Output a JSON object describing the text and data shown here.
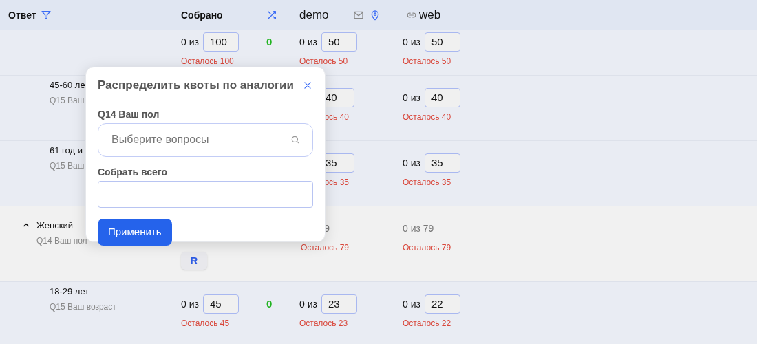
{
  "header": {
    "answer": "Ответ",
    "collected": "Собрано",
    "demo": "demo",
    "web": "web"
  },
  "rows": [
    {
      "kind": "option",
      "collected": {
        "prefix": "0 из",
        "value": "100",
        "remaining": "Осталось 100"
      },
      "difference": "0",
      "demo": {
        "prefix": "0 из",
        "value": "50",
        "remaining": "Осталось 50"
      },
      "web": {
        "prefix": "0 из",
        "value": "50",
        "remaining": "Осталось 50"
      }
    },
    {
      "kind": "option",
      "label": "45-60 ле",
      "sublabel": "Q15 Ваш",
      "demo": {
        "value": "40",
        "remaining": "ось 40"
      },
      "web": {
        "prefix": "0 из",
        "value": "40",
        "remaining": "Осталось 40"
      }
    },
    {
      "kind": "option",
      "label": "61 год и",
      "sublabel": "Q15 Ваш",
      "demo": {
        "value": "35",
        "remaining": "ось 35"
      },
      "web": {
        "prefix": "0 из",
        "value": "35",
        "remaining": "Осталось 35"
      }
    },
    {
      "kind": "group",
      "label": "Женский",
      "sublabel": "Q14 Ваш пол",
      "expanded": true,
      "demo": {
        "text": "9",
        "remaining": "Осталось 79"
      },
      "web": {
        "text": "0 из 79",
        "remaining": "Осталось 79"
      },
      "action": "R"
    },
    {
      "kind": "option",
      "label": "18-29 лет",
      "sublabel": "Q15 Ваш возраст",
      "collected": {
        "prefix": "0 из",
        "value": "45",
        "remaining": "Осталось 45"
      },
      "difference": "0",
      "demo": {
        "prefix": "0 из",
        "value": "23",
        "remaining": "Осталось 23"
      },
      "web": {
        "prefix": "0 из",
        "value": "22",
        "remaining": "Осталось 22"
      }
    }
  ],
  "popup": {
    "title": "Распределить квоты по аналогии",
    "fields": [
      {
        "kind": "search",
        "label": "Q14 Ваш пол",
        "placeholder": "Выберите вопросы"
      },
      {
        "kind": "text",
        "label": "Собрать всего"
      }
    ],
    "button": "Применить"
  }
}
